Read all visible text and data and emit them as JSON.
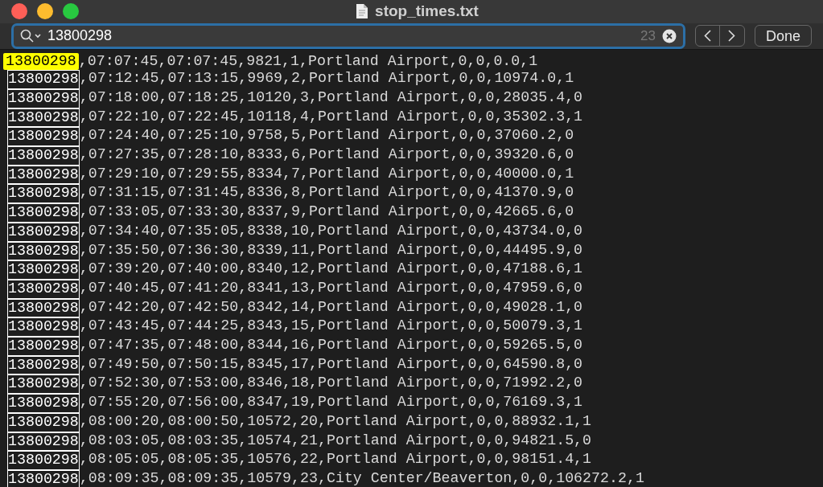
{
  "window": {
    "title": "stop_times.txt"
  },
  "find_bar": {
    "query": "13800298",
    "count": "23",
    "done_label": "Done"
  },
  "lines": [
    {
      "match": "13800298",
      "rest": ",07:07:45,07:07:45,9821,1,Portland Airport,0,0,0.0,1",
      "selected": true
    },
    {
      "match": "13800298",
      "rest": ",07:12:45,07:13:15,9969,2,Portland Airport,0,0,10974.0,1",
      "selected": false
    },
    {
      "match": "13800298",
      "rest": ",07:18:00,07:18:25,10120,3,Portland Airport,0,0,28035.4,0",
      "selected": false
    },
    {
      "match": "13800298",
      "rest": ",07:22:10,07:22:45,10118,4,Portland Airport,0,0,35302.3,1",
      "selected": false
    },
    {
      "match": "13800298",
      "rest": ",07:24:40,07:25:10,9758,5,Portland Airport,0,0,37060.2,0",
      "selected": false
    },
    {
      "match": "13800298",
      "rest": ",07:27:35,07:28:10,8333,6,Portland Airport,0,0,39320.6,0",
      "selected": false
    },
    {
      "match": "13800298",
      "rest": ",07:29:10,07:29:55,8334,7,Portland Airport,0,0,40000.0,1",
      "selected": false
    },
    {
      "match": "13800298",
      "rest": ",07:31:15,07:31:45,8336,8,Portland Airport,0,0,41370.9,0",
      "selected": false
    },
    {
      "match": "13800298",
      "rest": ",07:33:05,07:33:30,8337,9,Portland Airport,0,0,42665.6,0",
      "selected": false
    },
    {
      "match": "13800298",
      "rest": ",07:34:40,07:35:05,8338,10,Portland Airport,0,0,43734.0,0",
      "selected": false
    },
    {
      "match": "13800298",
      "rest": ",07:35:50,07:36:30,8339,11,Portland Airport,0,0,44495.9,0",
      "selected": false
    },
    {
      "match": "13800298",
      "rest": ",07:39:20,07:40:00,8340,12,Portland Airport,0,0,47188.6,1",
      "selected": false
    },
    {
      "match": "13800298",
      "rest": ",07:40:45,07:41:20,8341,13,Portland Airport,0,0,47959.6,0",
      "selected": false
    },
    {
      "match": "13800298",
      "rest": ",07:42:20,07:42:50,8342,14,Portland Airport,0,0,49028.1,0",
      "selected": false
    },
    {
      "match": "13800298",
      "rest": ",07:43:45,07:44:25,8343,15,Portland Airport,0,0,50079.3,1",
      "selected": false
    },
    {
      "match": "13800298",
      "rest": ",07:47:35,07:48:00,8344,16,Portland Airport,0,0,59265.5,0",
      "selected": false
    },
    {
      "match": "13800298",
      "rest": ",07:49:50,07:50:15,8345,17,Portland Airport,0,0,64590.8,0",
      "selected": false
    },
    {
      "match": "13800298",
      "rest": ",07:52:30,07:53:00,8346,18,Portland Airport,0,0,71992.2,0",
      "selected": false
    },
    {
      "match": "13800298",
      "rest": ",07:55:20,07:56:00,8347,19,Portland Airport,0,0,76169.3,1",
      "selected": false
    },
    {
      "match": "13800298",
      "rest": ",08:00:20,08:00:50,10572,20,Portland Airport,0,0,88932.1,1",
      "selected": false
    },
    {
      "match": "13800298",
      "rest": ",08:03:05,08:03:35,10574,21,Portland Airport,0,0,94821.5,0",
      "selected": false
    },
    {
      "match": "13800298",
      "rest": ",08:05:05,08:05:35,10576,22,Portland Airport,0,0,98151.4,1",
      "selected": false
    },
    {
      "match": "13800298",
      "rest": ",08:09:35,08:09:35,10579,23,City Center/Beaverton,0,0,106272.2,1",
      "selected": false
    }
  ]
}
